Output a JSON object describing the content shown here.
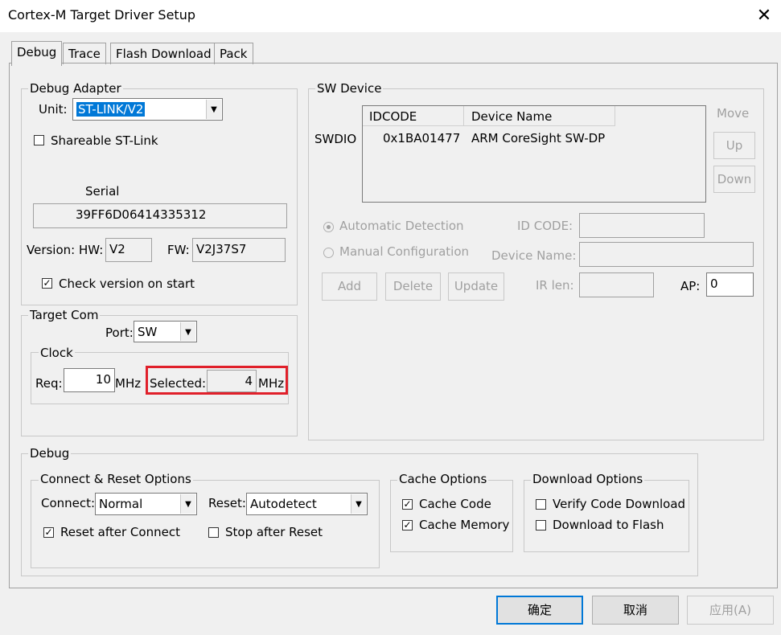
{
  "window": {
    "title": "Cortex-M Target Driver Setup",
    "close_glyph": "✕"
  },
  "tabs": [
    "Debug",
    "Trace",
    "Flash Download",
    "Pack"
  ],
  "debug_adapter": {
    "legend": "Debug Adapter",
    "unit_label": "Unit:",
    "unit_value": "ST-LINK/V2",
    "shareable_label": "Shareable ST-Link",
    "shareable_checked": false,
    "serial_label": "Serial",
    "serial_value": "39FF6D06414335312",
    "version_hw_label": "Version: HW:",
    "version_hw_value": "V2",
    "fw_label": "FW:",
    "fw_value": "V2J37S7",
    "check_version_label": "Check version on start",
    "check_version_checked": true
  },
  "target_com": {
    "legend": "Target Com",
    "port_label": "Port:",
    "port_value": "SW",
    "clock_legend": "Clock",
    "req_label": "Req:",
    "req_value": "10",
    "req_unit": "MHz",
    "selected_label": "Selected:",
    "selected_value": "4",
    "selected_unit": "MHz",
    "highlight_color": "#e0202a"
  },
  "sw_device": {
    "legend": "SW Device",
    "swdio_label": "SWDIO",
    "columns": [
      "IDCODE",
      "Device Name"
    ],
    "rows": [
      {
        "idcode": "0x1BA01477",
        "device_name": "ARM CoreSight SW-DP"
      }
    ],
    "move_label": "Move",
    "up_label": "Up",
    "down_label": "Down",
    "auto_detect_label": "Automatic Detection",
    "manual_config_label": "Manual Configuration",
    "id_code_label": "ID CODE:",
    "device_name_label": "Device Name:",
    "add_label": "Add",
    "delete_label": "Delete",
    "update_label": "Update",
    "ir_len_label": "IR len:",
    "ap_label": "AP:",
    "ap_value": "0"
  },
  "debug_section": {
    "legend": "Debug",
    "connect_reset": {
      "legend": "Connect & Reset Options",
      "connect_label": "Connect:",
      "connect_value": "Normal",
      "reset_label": "Reset:",
      "reset_value": "Autodetect",
      "reset_after_connect_label": "Reset after Connect",
      "reset_after_connect_checked": true,
      "stop_after_reset_label": "Stop after Reset",
      "stop_after_reset_checked": false
    },
    "cache": {
      "legend": "Cache Options",
      "cache_code_label": "Cache Code",
      "cache_code_checked": true,
      "cache_memory_label": "Cache Memory",
      "cache_memory_checked": true
    },
    "download": {
      "legend": "Download Options",
      "verify_label": "Verify Code Download",
      "verify_checked": false,
      "download_flash_label": "Download to Flash",
      "download_flash_checked": false
    }
  },
  "footer": {
    "ok_label": "确定",
    "cancel_label": "取消",
    "apply_label": "应用(A)"
  }
}
